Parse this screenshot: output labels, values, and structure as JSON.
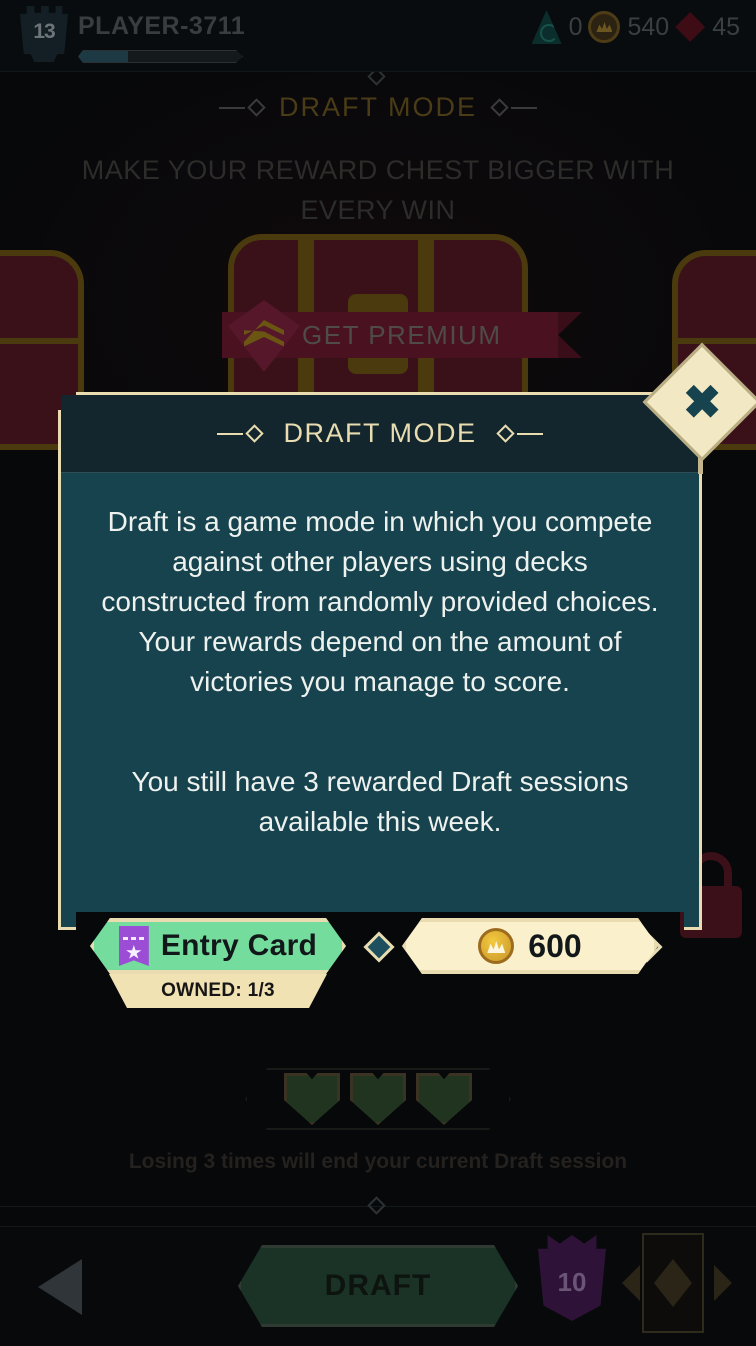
{
  "topbar": {
    "player_level": "13",
    "player_name": "PLAYER-3711",
    "currencies": [
      {
        "icon": "spiral-icon",
        "value": "0"
      },
      {
        "icon": "coin-icon",
        "value": "540"
      },
      {
        "icon": "gem-icon",
        "value": "45"
      }
    ]
  },
  "background": {
    "title": "DRAFT MODE",
    "subtitle": "MAKE YOUR REWARD CHEST BIGGER WITH EVERY WIN",
    "premium_label": "GET PREMIUM",
    "lose_note": "Losing 3 times will end your current Draft session",
    "hearts_count": 3
  },
  "dialog": {
    "title": "DRAFT MODE",
    "close_icon": "close-icon",
    "paragraph_1": "Draft is a game mode in which you compete against other players using decks constructed from randomly provided choices. Your rewards depend on the amount of victories you manage to score.",
    "paragraph_2": "You still have 3 rewarded Draft sessions available this week.",
    "entry_button": {
      "label": "Entry Card",
      "icon": "ticket-icon",
      "owned": "OWNED: 1/3"
    },
    "coin_button": {
      "label": "600",
      "icon": "coin-icon"
    }
  },
  "bottombar": {
    "back_icon": "back-arrow-icon",
    "draft_label": "DRAFT",
    "level_badge": "10"
  },
  "colors": {
    "gold_trim": "#e8dcb0",
    "dialog_body": "#17434f",
    "dialog_header": "#13262d",
    "entry_green": "#74dd9d",
    "coin_cream": "#fbf0cc",
    "ticket_purple": "#9b4dd6"
  }
}
